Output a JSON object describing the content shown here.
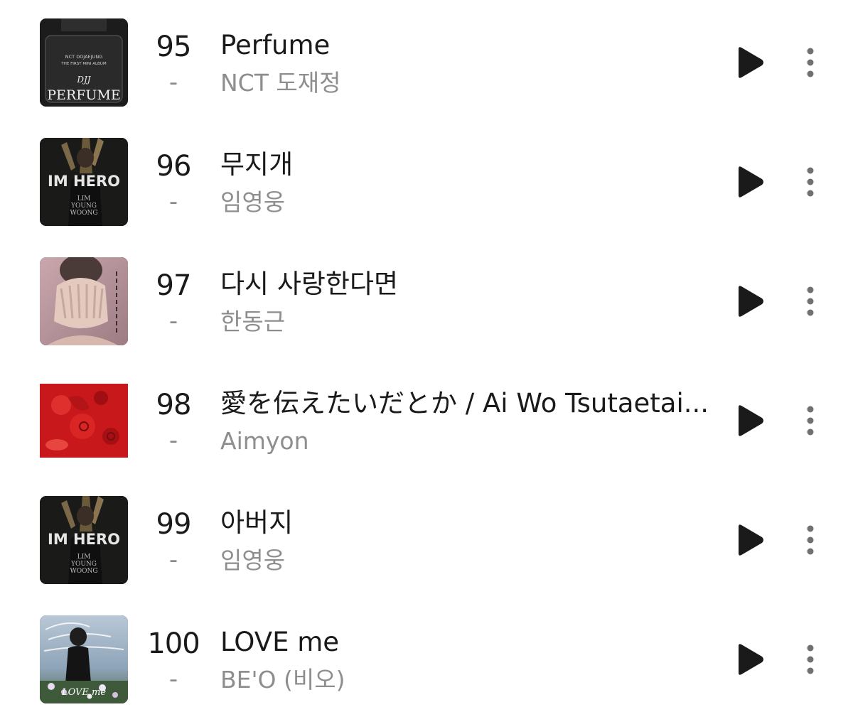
{
  "chart": {
    "items": [
      {
        "rank": "95",
        "change": "-",
        "title": "Perfume",
        "artist": "NCT 도재정",
        "art": {
          "kind": "perfume",
          "line1": "NCT DOJAEJUNG",
          "line2": "THE FIRST MINI ALBUM",
          "logo": "DJJ",
          "word": "PERFUME"
        }
      },
      {
        "rank": "96",
        "change": "-",
        "title": "무지개",
        "artist": "임영웅",
        "art": {
          "kind": "imhero",
          "word": "IM HERO",
          "line1": "LIM",
          "line2": "YOUNG",
          "line3": "WOONG"
        }
      },
      {
        "rank": "97",
        "change": "-",
        "title": "다시 사랑한다면",
        "artist": "한동근",
        "art": {
          "kind": "hands"
        }
      },
      {
        "rank": "98",
        "change": "-",
        "title": "愛を伝えたいだとか / Ai Wo Tsutaetai...",
        "artist": "Aimyon",
        "art": {
          "kind": "red"
        }
      },
      {
        "rank": "99",
        "change": "-",
        "title": "아버지",
        "artist": "임영웅",
        "art": {
          "kind": "imhero",
          "word": "IM HERO",
          "line1": "LIM",
          "line2": "YOUNG",
          "line3": "WOONG"
        }
      },
      {
        "rank": "100",
        "change": "-",
        "title": "LOVE me",
        "artist": "BE'O (비오)",
        "art": {
          "kind": "loveme",
          "word": "LOVE me"
        }
      }
    ]
  },
  "icons": {
    "play": "play-icon",
    "more": "more-vertical-icon"
  },
  "colors": {
    "text_primary": "#1a1a1a",
    "text_secondary": "#8e8e8e",
    "icon": "#1a1a1a",
    "more_dots": "#707070"
  }
}
